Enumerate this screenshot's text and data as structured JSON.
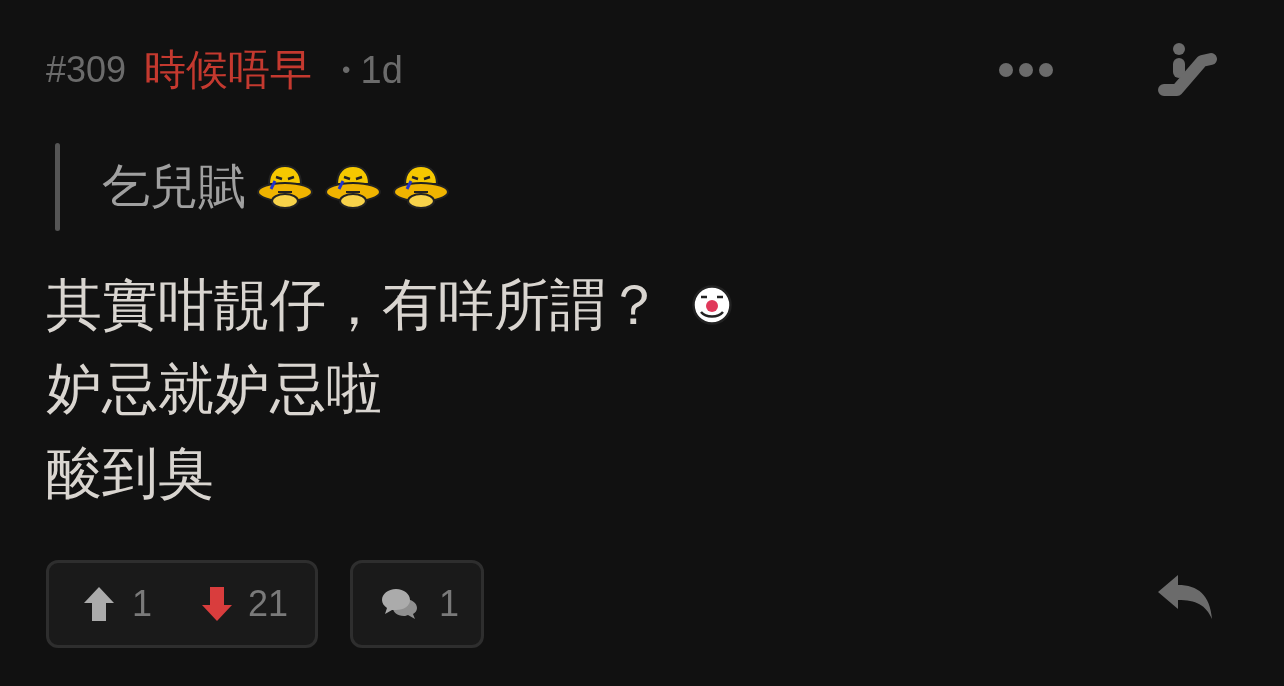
{
  "post": {
    "number": "#309",
    "author": "時候唔早",
    "separator": "•",
    "age": "1d"
  },
  "quote": {
    "parts": [
      {
        "kind": "text",
        "text": "乞兒賦"
      },
      {
        "kind": "emoticon"
      },
      {
        "kind": "emoticon"
      },
      {
        "kind": "emoticon"
      }
    ]
  },
  "body": {
    "lines": [
      {
        "parts": [
          {
            "kind": "text",
            "text": "其實咁靚仔，有咩所謂？"
          },
          {
            "kind": "emoticon"
          }
        ]
      },
      {
        "parts": [
          {
            "kind": "text",
            "text": "妒忌就妒忌啦"
          }
        ]
      },
      {
        "parts": [
          {
            "kind": "text",
            "text": "酸到臭"
          }
        ]
      }
    ]
  },
  "votes": {
    "up": "1",
    "down": "21"
  },
  "comments": {
    "count": "1"
  }
}
